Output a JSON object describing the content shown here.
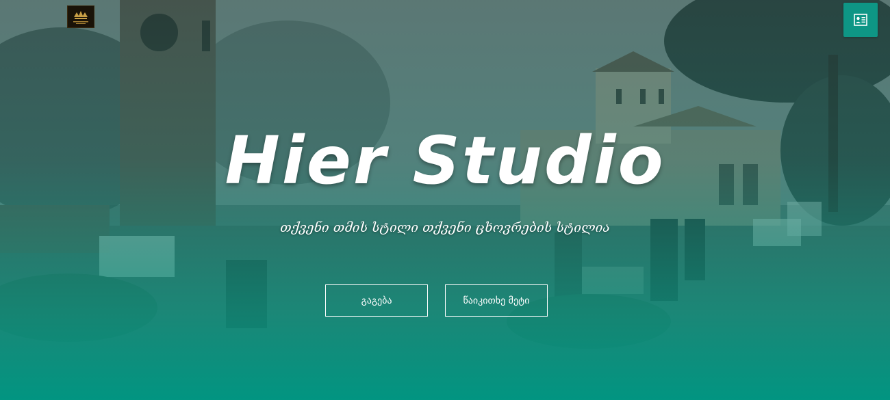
{
  "hero": {
    "title": "Hier Studio",
    "subtitle": "თქვენი თმის სტილი თქვენი ცხოვრების სტილია",
    "buttons": {
      "learn_label": "გაგება",
      "read_more_label": "წაიკითხე მეტი"
    }
  },
  "header": {
    "logo_icon": "crown-crest-logo",
    "contact_icon": "contact-card-icon"
  },
  "colors": {
    "accent": "#0e9685",
    "overlay_bottom": "#009682",
    "text": "#ffffff"
  }
}
